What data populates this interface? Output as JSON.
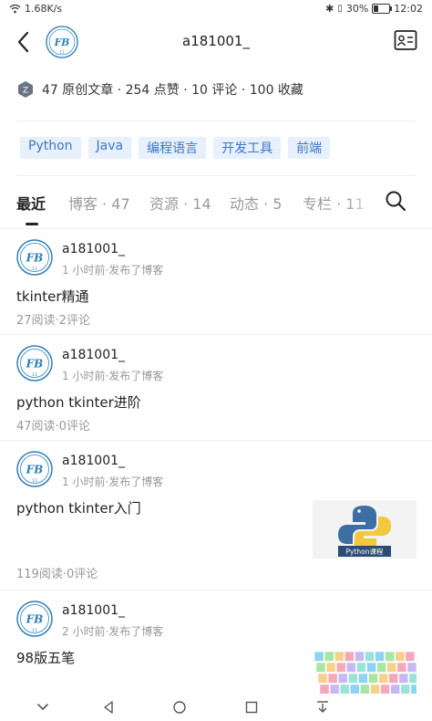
{
  "statusbar": {
    "speed": "1.68K/s",
    "battery_percent": 30,
    "battery_text": "30%",
    "time": "12:02"
  },
  "header": {
    "username": "a181001_",
    "avatar_text": "FB",
    "avatar_sub": "11"
  },
  "profile_stats": {
    "text": "47 原创文章 · 254 点赞 · 10 评论 · 100 收藏"
  },
  "tags": [
    "Python",
    "Java",
    "编程语言",
    "开发工具",
    "前端"
  ],
  "tabs": {
    "active": "最近",
    "blog": "博客 · 47",
    "resources": "资源 · 14",
    "activity": "动态 · 5",
    "columns": "专栏 · 11"
  },
  "posts": [
    {
      "author": "a181001_",
      "meta": "1 小时前·发布了博客",
      "title": "tkinter精通",
      "stats": "27阅读·2评论"
    },
    {
      "author": "a181001_",
      "meta": "1 小时前·发布了博客",
      "title": "python tkinter进阶",
      "stats": "47阅读·0评论"
    },
    {
      "author": "a181001_",
      "meta": "1 小时前·发布了博客",
      "title": "python tkinter入门",
      "stats": "119阅读·0评论",
      "thumb_caption": "Python课程"
    },
    {
      "author": "a181001_",
      "meta": "2 小时前·发布了博客",
      "title": "98版五笔"
    }
  ],
  "colors": {
    "accent": "#3b78c8",
    "tag_bg": "#e7f0fb",
    "muted": "#999999"
  }
}
